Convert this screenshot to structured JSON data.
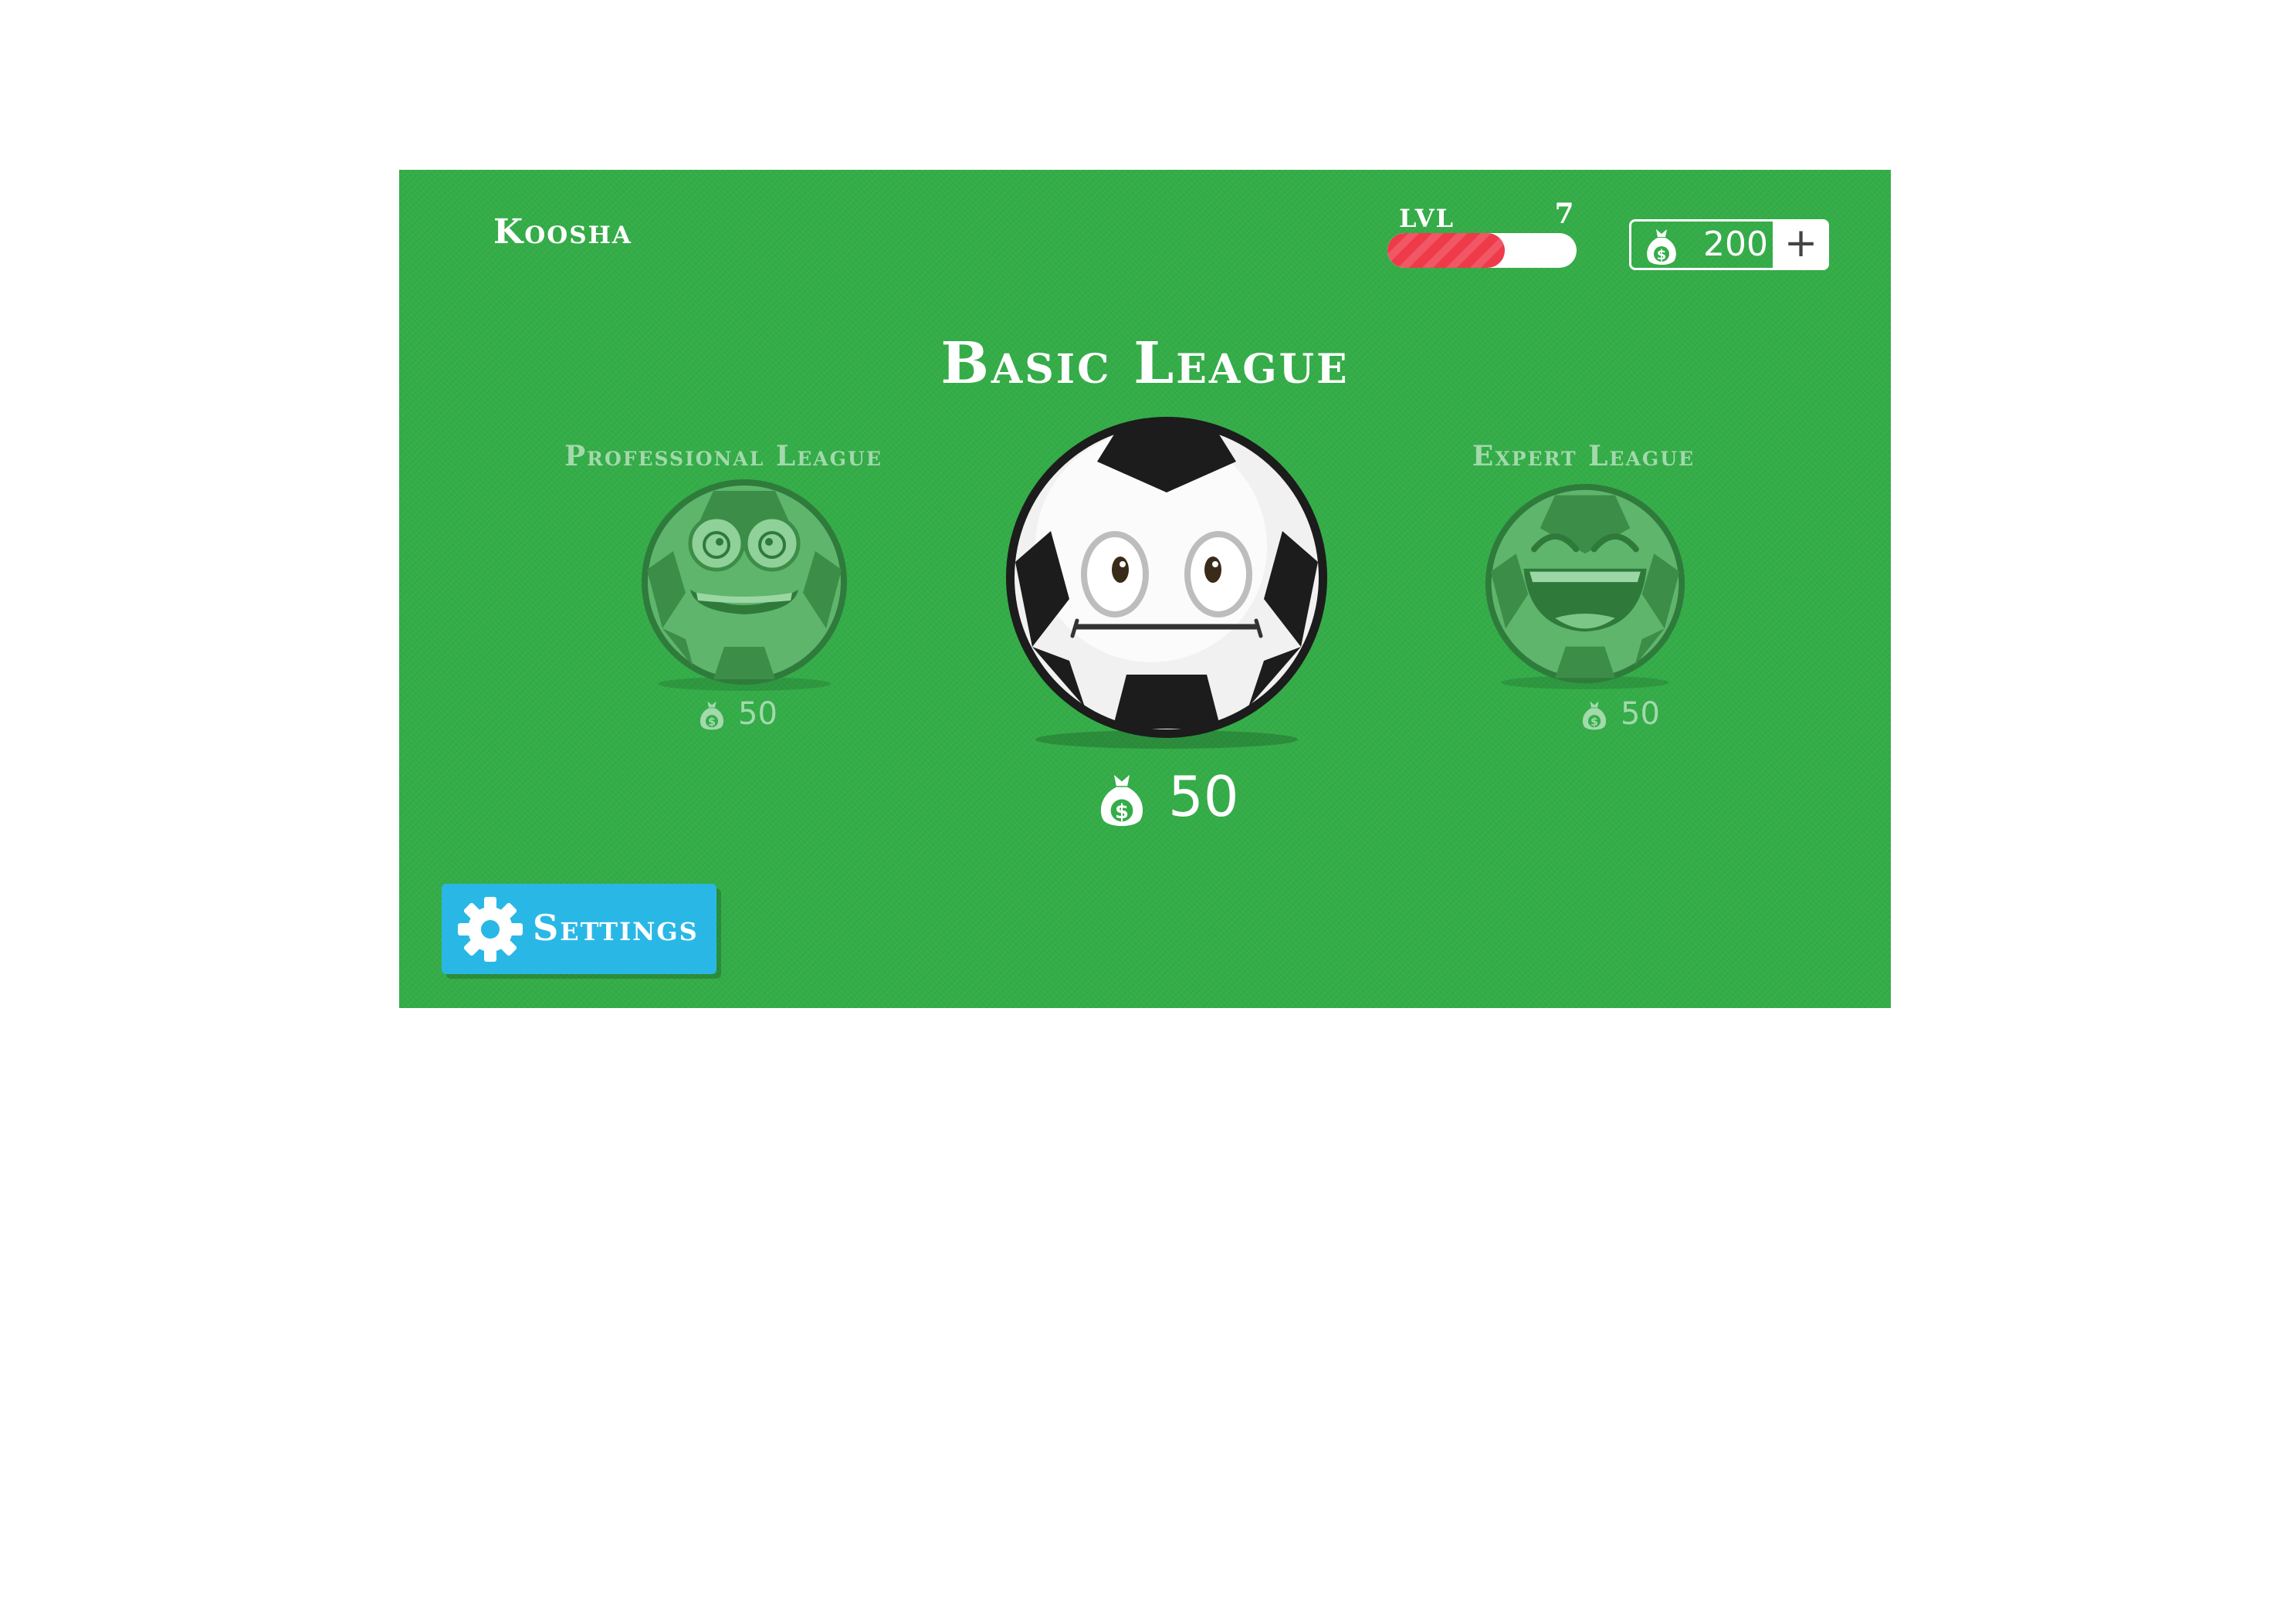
{
  "player": {
    "name": "Koosha"
  },
  "level": {
    "label": "LVL",
    "value": "7",
    "progress": 0.62
  },
  "coins": {
    "amount": "200",
    "add_label": "+",
    "icon": "money-bag-icon"
  },
  "leagues": {
    "current": {
      "title": "Basic League",
      "price": "50"
    },
    "left": {
      "title": "Professional League",
      "price": "50"
    },
    "right": {
      "title": "Expert League",
      "price": "50"
    }
  },
  "settings": {
    "label": "Settings",
    "icon": "gear-icon"
  },
  "colors": {
    "background": "#34ad48",
    "level_fill": "#ef3a4a",
    "settings_button": "#29b8e6",
    "dim_text": "#a3d9ac"
  }
}
